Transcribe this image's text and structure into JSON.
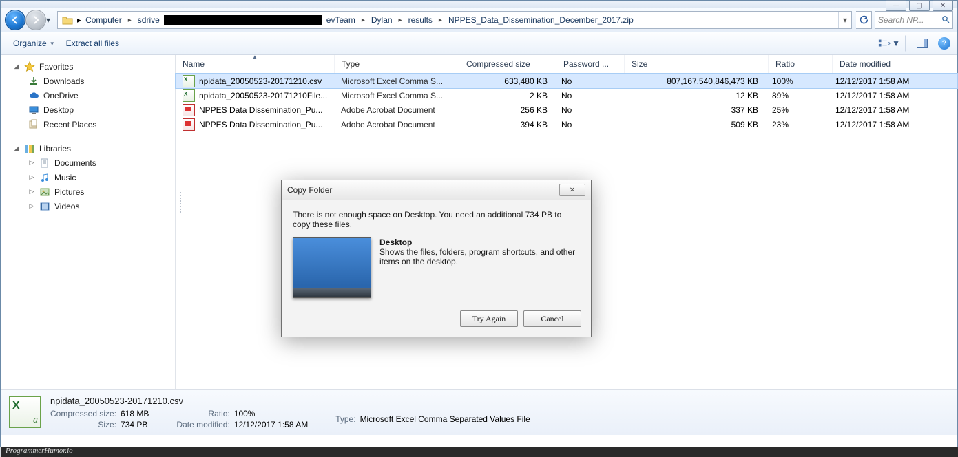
{
  "window": {
    "controls": {
      "min": "—",
      "max": "▢",
      "close": "✕"
    }
  },
  "breadcrumb": {
    "segments": [
      "Computer",
      "sdrive",
      "evTeam",
      "Dylan",
      "results",
      "NPPES_Data_Dissemination_December_2017.zip"
    ]
  },
  "search": {
    "placeholder": "Search NP..."
  },
  "commandbar": {
    "organize": "Organize",
    "extract": "Extract all files"
  },
  "navpane": {
    "favorites": {
      "label": "Favorites",
      "items": [
        "Downloads",
        "OneDrive",
        "Desktop",
        "Recent Places"
      ]
    },
    "libraries": {
      "label": "Libraries",
      "items": [
        "Documents",
        "Music",
        "Pictures",
        "Videos"
      ]
    }
  },
  "columns": {
    "name": "Name",
    "type": "Type",
    "csize": "Compressed size",
    "pw": "Password ...",
    "size": "Size",
    "ratio": "Ratio",
    "date": "Date modified"
  },
  "files": [
    {
      "icon": "csv",
      "name": "npidata_20050523-20171210.csv",
      "type": "Microsoft Excel Comma S...",
      "csize": "633,480 KB",
      "pw": "No",
      "size": "807,167,540,846,473 KB",
      "ratio": "100%",
      "date": "12/12/2017 1:58 AM",
      "selected": true
    },
    {
      "icon": "csv",
      "name": "npidata_20050523-20171210File...",
      "type": "Microsoft Excel Comma S...",
      "csize": "2 KB",
      "pw": "No",
      "size": "12 KB",
      "ratio": "89%",
      "date": "12/12/2017 1:58 AM"
    },
    {
      "icon": "pdf",
      "name": "NPPES Data Dissemination_Pu...",
      "type": "Adobe Acrobat Document",
      "csize": "256 KB",
      "pw": "No",
      "size": "337 KB",
      "ratio": "25%",
      "date": "12/12/2017 1:58 AM"
    },
    {
      "icon": "pdf",
      "name": "NPPES Data Dissemination_Pu...",
      "type": "Adobe Acrobat Document",
      "csize": "394 KB",
      "pw": "No",
      "size": "509 KB",
      "ratio": "23%",
      "date": "12/12/2017 1:58 AM"
    }
  ],
  "details": {
    "name": "npidata_20050523-20171210.csv",
    "csize_k": "Compressed size:",
    "csize_v": "618 MB",
    "size_k": "Size:",
    "size_v": "734 PB",
    "ratio_k": "Ratio:",
    "ratio_v": "100%",
    "date_k": "Date modified:",
    "date_v": "12/12/2017 1:58 AM",
    "type_k": "Type:",
    "type_v": "Microsoft Excel Comma Separated Values File"
  },
  "dialog": {
    "title": "Copy Folder",
    "message": "There is not enough space on Desktop. You need an additional 734 PB to copy these files.",
    "dest_name": "Desktop",
    "dest_desc": "Shows the files, folders, program shortcuts, and other items on the desktop.",
    "try_again": "Try Again",
    "cancel": "Cancel"
  },
  "watermark": "ProgrammerHumor.io"
}
